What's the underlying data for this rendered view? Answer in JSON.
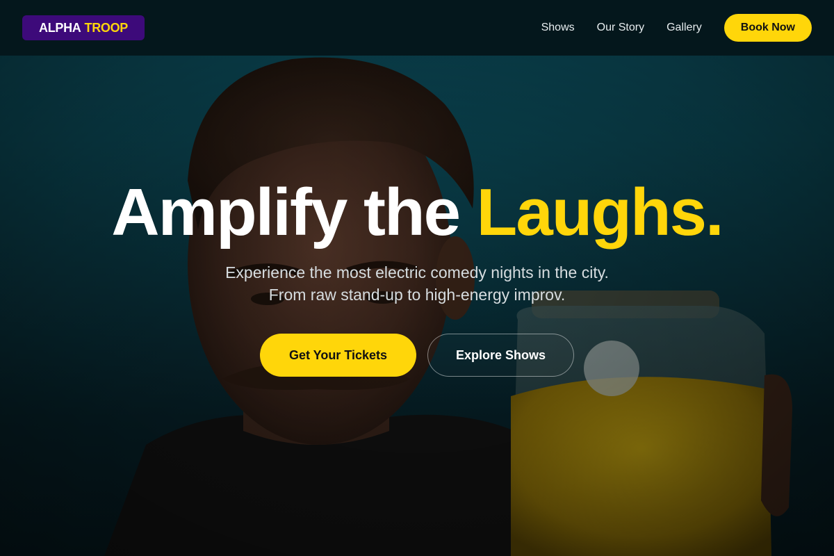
{
  "brand": {
    "name_part1": "ALPHA",
    "name_part2": "TROOP",
    "bg_color": "#3d0a7a",
    "accent_color": "#ffd60a"
  },
  "nav": {
    "links": [
      "Shows",
      "Our Story",
      "Gallery"
    ],
    "cta_label": "Book Now"
  },
  "hero": {
    "headline_part1": "Amplify the",
    "headline_accent": "Laughs.",
    "subtext_line1": "Experience the most electric comedy nights in the city.",
    "subtext_line2": "From raw stand-up to high-energy improv.",
    "primary_cta": "Get Your Tickets",
    "secondary_cta": "Explore Shows",
    "background_image": "man-holding-candy-jar-photo"
  }
}
